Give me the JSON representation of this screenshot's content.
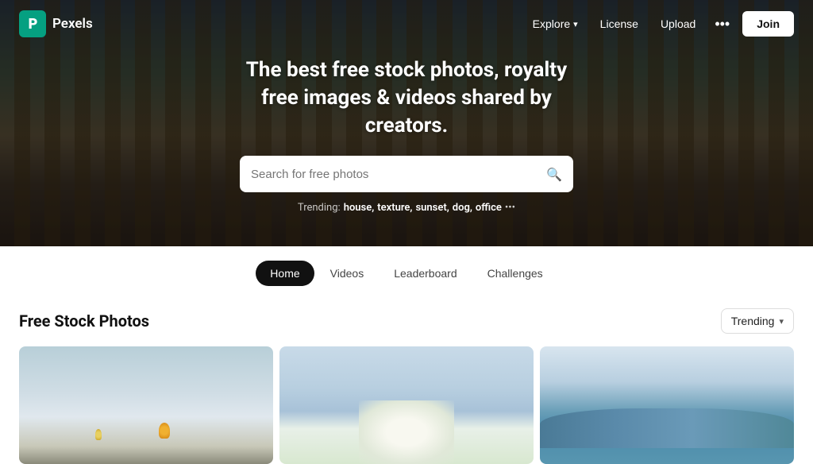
{
  "brand": {
    "logo_letter": "P",
    "name": "Pexels"
  },
  "nav": {
    "explore_label": "Explore",
    "license_label": "License",
    "upload_label": "Upload",
    "join_label": "Join"
  },
  "hero": {
    "title": "The best free stock photos, royalty free images & videos shared by creators.",
    "search_placeholder": "Search for free photos",
    "trending_label": "Trending:",
    "trending_tags": [
      "house",
      "texture",
      "sunset",
      "dog",
      "office"
    ]
  },
  "tabs": [
    {
      "id": "home",
      "label": "Home",
      "active": true
    },
    {
      "id": "videos",
      "label": "Videos",
      "active": false
    },
    {
      "id": "leaderboard",
      "label": "Leaderboard",
      "active": false
    },
    {
      "id": "challenges",
      "label": "Challenges",
      "active": false
    }
  ],
  "photos_section": {
    "title": "Free Stock Photos",
    "sort_label": "Trending",
    "photos": [
      {
        "id": "1",
        "alt": "Hot air balloons in sky"
      },
      {
        "id": "2",
        "alt": "White flower close-up"
      },
      {
        "id": "3",
        "alt": "Ocean waves with cloudy sky"
      }
    ]
  }
}
